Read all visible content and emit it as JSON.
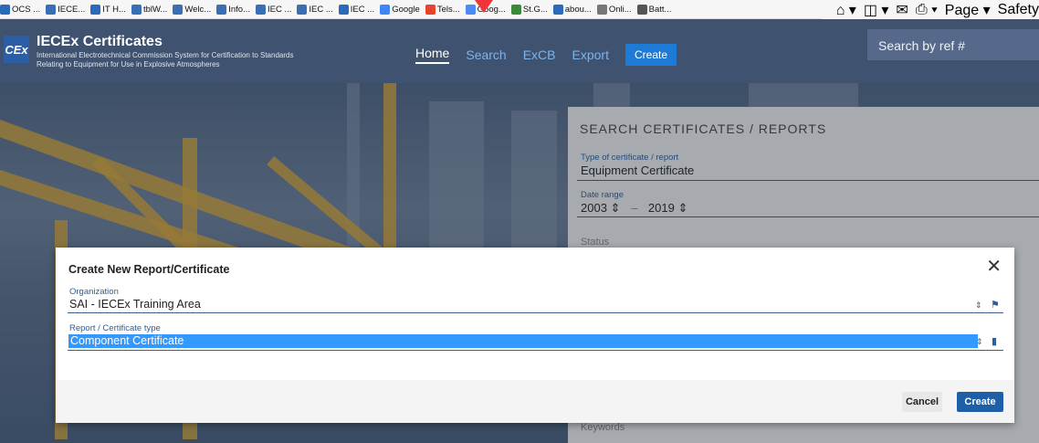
{
  "browser": {
    "favorites": [
      {
        "label": "OCS ...",
        "color": "#2a6ab8"
      },
      {
        "label": "IECE...",
        "color": "#3b6fb5"
      },
      {
        "label": "IT H...",
        "color": "#2a6ab8"
      },
      {
        "label": "tblW...",
        "color": "#3b6fb5"
      },
      {
        "label": "Welc...",
        "color": "#3b6fb5"
      },
      {
        "label": "Info...",
        "color": "#3b6fb5"
      },
      {
        "label": "IEC ...",
        "color": "#3b6fb5"
      },
      {
        "label": "IEC ...",
        "color": "#3b6fb5"
      },
      {
        "label": "IEC ...",
        "color": "#2a6ab8"
      },
      {
        "label": "Google",
        "color": "#4285f4"
      },
      {
        "label": "Tels...",
        "color": "#e5452f"
      },
      {
        "label": "Goog...",
        "color": "#4c8bf5"
      },
      {
        "label": "St.G...",
        "color": "#3a8a3a"
      },
      {
        "label": "abou...",
        "color": "#2a6ab8"
      },
      {
        "label": "Onli...",
        "color": "#777777"
      },
      {
        "label": "Batt...",
        "color": "#555555"
      }
    ],
    "toolbar_right": {
      "page_label": "Page ▾",
      "safety_label": "Safety"
    }
  },
  "header": {
    "logo_text": "CEx",
    "title": "IECEx Certificates",
    "subtitle_line1": "International Electrotechnical Commission System for Certification to Standards",
    "subtitle_line2": "Relating to Equipment for Use in Explosive Atmospheres",
    "nav": [
      {
        "label": "Home",
        "active": true
      },
      {
        "label": "Search",
        "active": false
      },
      {
        "label": "ExCB",
        "active": false
      },
      {
        "label": "Export",
        "active": false
      }
    ],
    "create_label": "Create",
    "search_ref_placeholder": "Search by ref #"
  },
  "search_panel": {
    "title": "SEARCH CERTIFICATES / REPORTS",
    "type_label": "Type of certificate / report",
    "type_value": "Equipment Certificate",
    "date_label": "Date range",
    "date_from": "2003",
    "date_to": "2019",
    "date_sep": "–",
    "status_label": "Status",
    "keywords_label": "Keywords"
  },
  "modal": {
    "title": "Create New Report/Certificate",
    "close_glyph": "✕",
    "org_label": "Organization",
    "org_value": "SAI - IECEx Training Area",
    "type_label": "Report / Certificate type",
    "type_value": "Component Certificate",
    "cancel_label": "Cancel",
    "create_label": "Create"
  },
  "colors": {
    "header_bg": "#3f5270",
    "accent": "#1d7bd6",
    "primary_button": "#1f5fa8",
    "selection": "#3399ff"
  }
}
